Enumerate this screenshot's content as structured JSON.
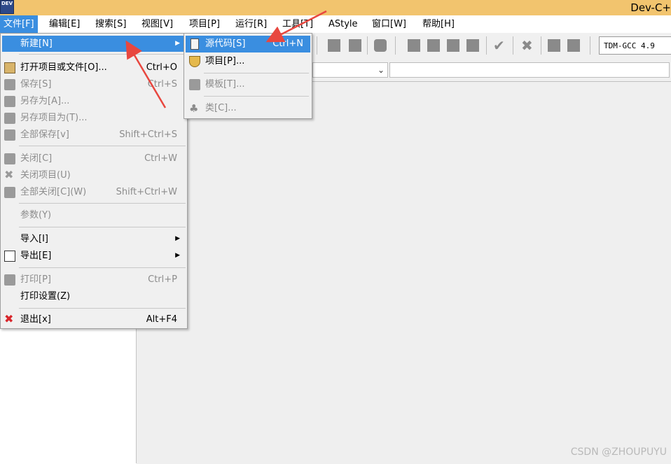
{
  "window": {
    "title": "Dev-C+",
    "icon_text": "DEV"
  },
  "menubar": {
    "items": [
      {
        "label": "文件[F]",
        "active": true
      },
      {
        "label": "编辑[E]"
      },
      {
        "label": "搜索[S]"
      },
      {
        "label": "视图[V]"
      },
      {
        "label": "项目[P]"
      },
      {
        "label": "运行[R]"
      },
      {
        "label": "工具[T]"
      },
      {
        "label": "AStyle"
      },
      {
        "label": "窗口[W]"
      },
      {
        "label": "帮助[H]"
      }
    ]
  },
  "toolbar": {
    "compiler": "TDM-GCC 4.9"
  },
  "file_menu": {
    "items": [
      {
        "label": "新建[N]",
        "shortcut": "",
        "state": "highlighted",
        "submenu": true
      },
      {
        "label": "打开项目或文件[O]...",
        "shortcut": "Ctrl+O",
        "state": "enabled"
      },
      {
        "label": "保存[S]",
        "shortcut": "Ctrl+S",
        "state": "disabled"
      },
      {
        "label": "另存为[A]...",
        "shortcut": "",
        "state": "disabled"
      },
      {
        "label": "另存项目为(T)...",
        "shortcut": "",
        "state": "disabled"
      },
      {
        "label": "全部保存[v]",
        "shortcut": "Shift+Ctrl+S",
        "state": "disabled"
      },
      {
        "label": "关闭[C]",
        "shortcut": "Ctrl+W",
        "state": "disabled"
      },
      {
        "label": "关闭项目(U)",
        "shortcut": "",
        "state": "disabled"
      },
      {
        "label": "全部关闭[C](W)",
        "shortcut": "Shift+Ctrl+W",
        "state": "disabled"
      },
      {
        "label": "参数(Y)",
        "shortcut": "",
        "state": "disabled"
      },
      {
        "label": "导入[I]",
        "shortcut": "",
        "state": "enabled",
        "submenu": true
      },
      {
        "label": "导出[E]",
        "shortcut": "",
        "state": "enabled",
        "submenu": true
      },
      {
        "label": "打印[P]",
        "shortcut": "Ctrl+P",
        "state": "disabled"
      },
      {
        "label": "打印设置(Z)",
        "shortcut": "",
        "state": "enabled"
      },
      {
        "label": "退出[x]",
        "shortcut": "Alt+F4",
        "state": "enabled"
      }
    ]
  },
  "new_submenu": {
    "items": [
      {
        "label": "源代码[S]",
        "shortcut": "Ctrl+N",
        "state": "highlighted"
      },
      {
        "label": "项目[P]...",
        "shortcut": "",
        "state": "enabled"
      },
      {
        "label": "模板[T]...",
        "shortcut": "",
        "state": "disabled"
      },
      {
        "label": "类[C]...",
        "shortcut": "",
        "state": "disabled"
      }
    ]
  },
  "watermark": "CSDN @ZHOUPUYU",
  "colors": {
    "menu_highlight": "#3a8ee0",
    "title_bar": "#f2c46e",
    "annotation_arrow": "#e8473f"
  }
}
